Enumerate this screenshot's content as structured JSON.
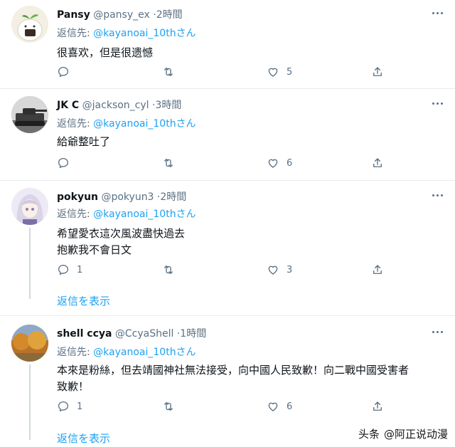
{
  "labels": {
    "reply_prefix": "返信先:",
    "show_replies": "返信を表示"
  },
  "tweets": [
    {
      "name": "Pansy",
      "handle": "@pansy_ex",
      "time": "2時間",
      "reply_to": "@kayanoai_10thさん",
      "text": [
        "很喜欢，但是很遗憾"
      ],
      "replies": "",
      "retweets": "",
      "likes": "5"
    },
    {
      "name": "JK C",
      "handle": "@jackson_cyl",
      "time": "3時間",
      "reply_to": "@kayanoai_10thさん",
      "text": [
        "給爺整吐了"
      ],
      "replies": "",
      "retweets": "",
      "likes": "6"
    },
    {
      "name": "pokyun",
      "handle": "@pokyun3",
      "time": "2時間",
      "reply_to": "@kayanoai_10thさん",
      "text": [
        "希望愛衣這次風波盡快過去",
        "抱歉我不會日文"
      ],
      "replies": "1",
      "retweets": "",
      "likes": "3"
    },
    {
      "name": "shell ccya",
      "handle": "@CcyaShell",
      "time": "1時間",
      "reply_to": "@kayanoai_10thさん",
      "text": [
        "本來是粉絲，但去靖國神社無法接受，向中國人民致歉！向二戰中國受害者",
        "致歉！"
      ],
      "replies": "1",
      "retweets": "",
      "likes": "6"
    }
  ],
  "watermark": {
    "prefix": "头条",
    "handle": "@阿正说动漫"
  },
  "colors": {
    "accent": "#1da1f2",
    "muted": "#5b7083",
    "separator": "#e6ecf0"
  }
}
